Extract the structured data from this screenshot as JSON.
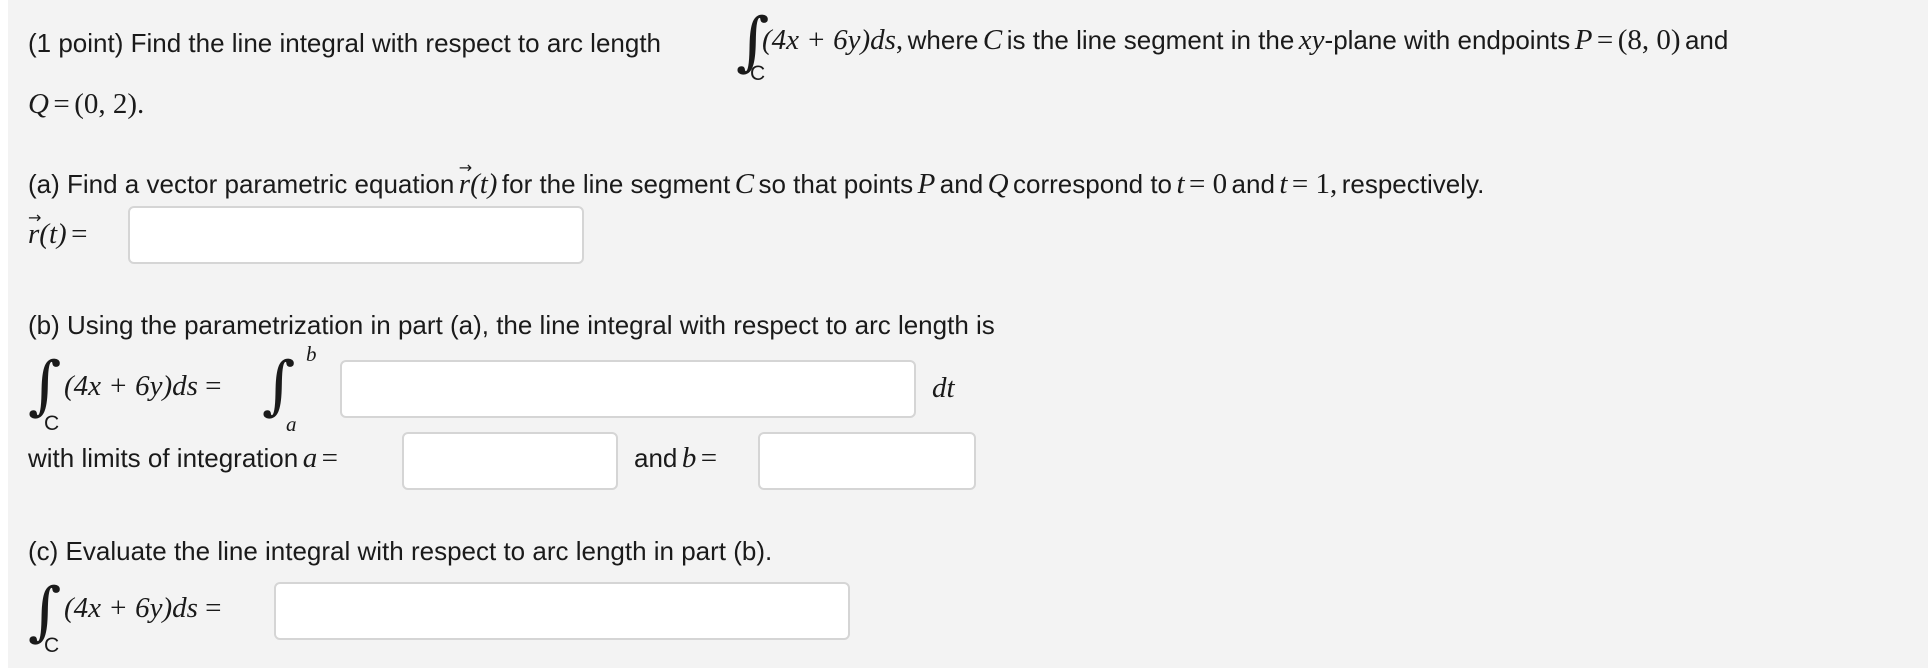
{
  "question": {
    "points_label": "(1 point) Find the line integral with respect to arc length",
    "integrand": "(4x + 6y)ds,",
    "where_text": "where",
    "C_var": "C",
    "segment_text": "is the line segment in the",
    "xy_var": "xy",
    "plane_text": "-plane with endpoints",
    "P_var": "P",
    "equals": "=",
    "P_value": "(8, 0)",
    "and_text": "and",
    "Q_var": "Q",
    "Q_value": "(0, 2).",
    "integral_subscript": "C"
  },
  "part_a": {
    "prompt_1": "(a) Find a vector parametric equation",
    "r_var": "r",
    "t_arg": "(t)",
    "prompt_2": "for the line segment",
    "prompt_C": "C",
    "prompt_3": "so that points",
    "prompt_P": "P",
    "prompt_and": "and",
    "prompt_Q": "Q",
    "prompt_4": "correspond to",
    "t_var": "t",
    "eq0": "= 0",
    "and2": "and",
    "t_var2": "t",
    "eq1": "= 1,",
    "prompt_5": "respectively.",
    "answer_label_eq": "=",
    "answer_value": "",
    "vector_arrow": "⃗"
  },
  "part_b": {
    "prompt": "(b) Using the parametrization in part (a), the line integral with respect to arc length is",
    "integrand": "(4x + 6y)ds =",
    "sub_C": "C",
    "lim_b": "b",
    "lim_a": "a",
    "dt": "dt",
    "integrand_value": "",
    "limits_label": "with limits of integration",
    "a_var": "a",
    "a_eq": "=",
    "a_value": "",
    "and_text": "and",
    "b_var": "b",
    "b_eq": "=",
    "b_value": ""
  },
  "part_c": {
    "prompt": "(c) Evaluate the line integral with respect to arc length in part (b).",
    "integrand": "(4x + 6y)ds =",
    "sub_C": "C",
    "answer_value": ""
  }
}
